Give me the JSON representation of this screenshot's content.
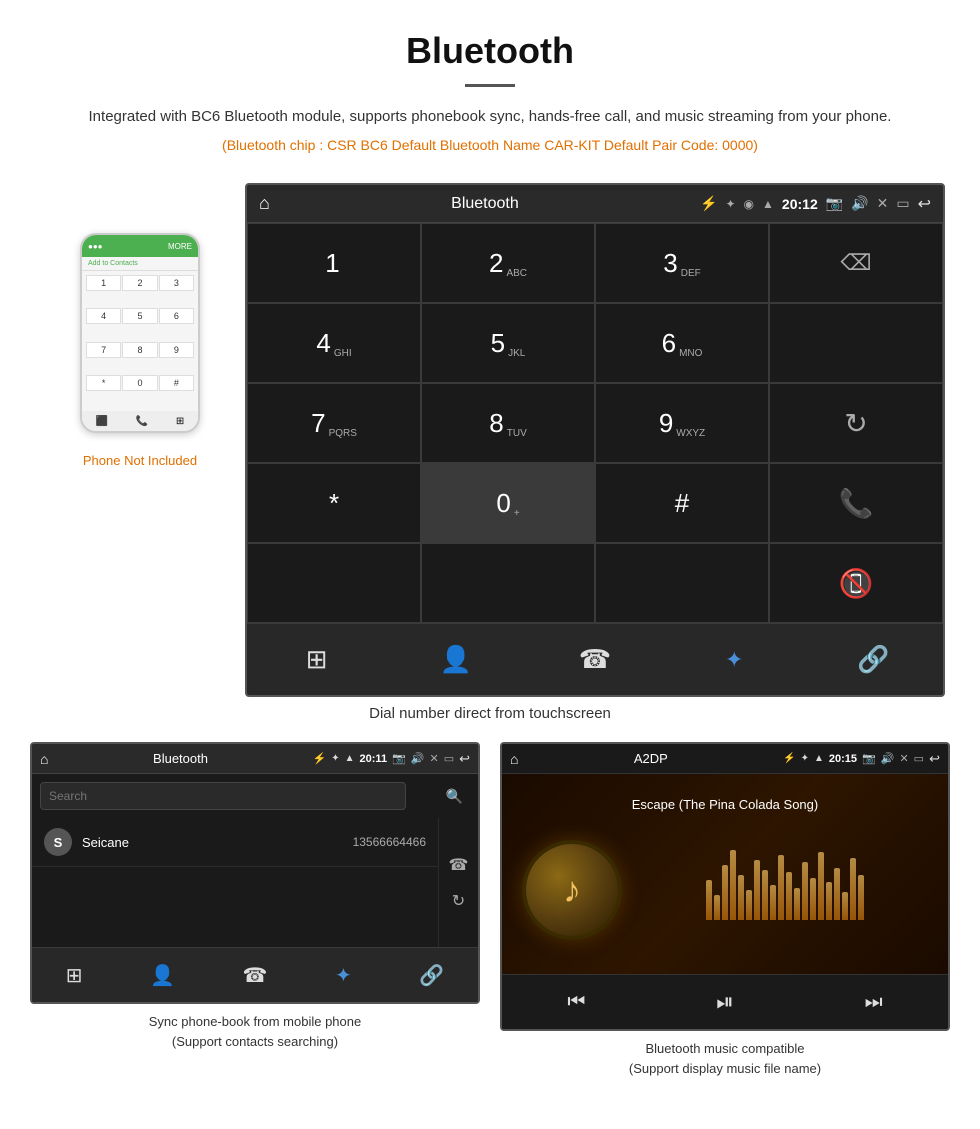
{
  "header": {
    "title": "Bluetooth",
    "description": "Integrated with BC6 Bluetooth module, supports phonebook sync, hands-free call, and music streaming from your phone.",
    "specs": "(Bluetooth chip : CSR BC6    Default Bluetooth Name CAR-KIT    Default Pair Code: 0000)"
  },
  "phone": {
    "not_included_label": "Phone Not Included",
    "dial_keys": [
      "1",
      "2",
      "3",
      "4",
      "5",
      "6",
      "7",
      "8",
      "9",
      "*",
      "0",
      "#"
    ],
    "add_contacts": "Add to Contacts",
    "more_label": "MORE"
  },
  "car_screen": {
    "status_bar": {
      "title": "Bluetooth",
      "time": "20:12"
    },
    "dialpad": {
      "keys": [
        {
          "main": "1",
          "sub": ""
        },
        {
          "main": "2",
          "sub": "ABC"
        },
        {
          "main": "3",
          "sub": "DEF"
        },
        {
          "main": "",
          "sub": ""
        },
        {
          "main": "4",
          "sub": "GHI"
        },
        {
          "main": "5",
          "sub": "JKL"
        },
        {
          "main": "6",
          "sub": "MNO"
        },
        {
          "main": "",
          "sub": ""
        },
        {
          "main": "7",
          "sub": "PQRS"
        },
        {
          "main": "8",
          "sub": "TUV"
        },
        {
          "main": "9",
          "sub": "WXYZ"
        },
        {
          "main": "",
          "sub": ""
        },
        {
          "main": "*",
          "sub": ""
        },
        {
          "main": "0",
          "sub": "+"
        },
        {
          "main": "#",
          "sub": ""
        }
      ]
    },
    "caption": "Dial number direct from touchscreen"
  },
  "phonebook_screen": {
    "status_bar": {
      "title": "Bluetooth",
      "time": "20:11"
    },
    "search_placeholder": "Search",
    "contacts": [
      {
        "initial": "S",
        "name": "Seicane",
        "number": "13566664466"
      }
    ],
    "caption_line1": "Sync phone-book from mobile phone",
    "caption_line2": "(Support contacts searching)"
  },
  "music_screen": {
    "status_bar": {
      "title": "A2DP",
      "time": "20:15"
    },
    "song_title": "Escape (The Pina Colada Song)",
    "caption_line1": "Bluetooth music compatible",
    "caption_line2": "(Support display music file name)"
  },
  "icons": {
    "home": "⌂",
    "back": "↩",
    "usb": "⚡",
    "bluetooth": "✦",
    "wifi": "▲",
    "volume": "♪",
    "camera": "📷",
    "close_x": "✕",
    "window": "▭",
    "backspace": "⌫",
    "refresh": "↻",
    "call_green": "📞",
    "call_red": "📵",
    "dialpad": "⊞",
    "contacts": "👤",
    "phone": "☎",
    "bt_small": "✦",
    "link": "🔗",
    "search": "🔍",
    "prev": "⏮",
    "play_pause": "⏯",
    "next": "⏭"
  },
  "viz_bars": [
    40,
    25,
    55,
    70,
    45,
    30,
    60,
    50,
    35,
    65,
    48,
    32,
    58,
    42,
    68,
    38,
    52,
    28,
    62,
    45
  ]
}
